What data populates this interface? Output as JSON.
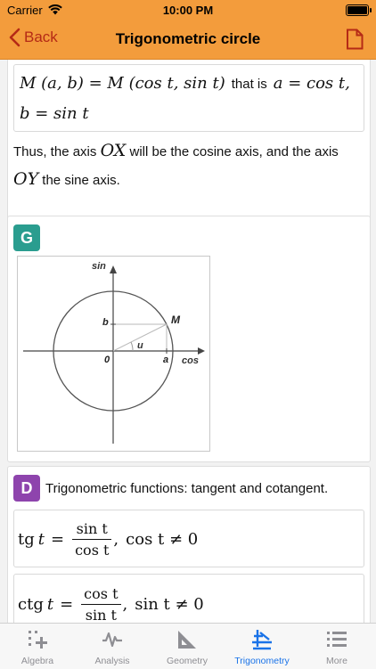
{
  "status_bar": {
    "carrier": "Carrier",
    "time": "10:00 PM"
  },
  "nav": {
    "back_label": "Back",
    "title": "Trigonometric circle"
  },
  "section_top": {
    "formula": {
      "lhs": "M (a, b) = M (cos t, sin t)",
      "connector": "that is",
      "rhs1": "a = cos t,",
      "rhs2": "b = sin t"
    },
    "paragraph": {
      "p1": "Thus, the axis",
      "axis1": "OX",
      "p2": "will be the cosine axis, and the axis",
      "axis2": "OY",
      "p3": "the sine axis."
    }
  },
  "section_g": {
    "badge": "G",
    "badge_color": "#2a9d8f",
    "diagram_labels": {
      "sin": "sin",
      "cos": "cos",
      "M": "M",
      "b": "b",
      "a": "a",
      "u": "u",
      "origin": "0"
    }
  },
  "section_d": {
    "badge": "D",
    "badge_color": "#8e44ad",
    "heading": "Trigonometric functions: tangent and cotangent.",
    "tangent": {
      "name": "tg",
      "var": "t",
      "num": "sin t",
      "den": "cos t",
      "condition": "cos t ≠ 0"
    },
    "cotangent": {
      "name": "ctg",
      "var": "t",
      "num": "cos t",
      "den": "sin t",
      "condition": "sin t ≠ 0"
    }
  },
  "tab_bar": {
    "items": [
      {
        "label": "Algebra",
        "icon": "algebra-icon"
      },
      {
        "label": "Analysis",
        "icon": "analysis-icon"
      },
      {
        "label": "Geometry",
        "icon": "geometry-icon"
      },
      {
        "label": "Trigonometry",
        "icon": "trigonometry-icon"
      },
      {
        "label": "More",
        "icon": "more-icon"
      }
    ],
    "active_index": 3,
    "active_color": "#1a73e8",
    "inactive_color": "#8e8e93"
  },
  "colors": {
    "accent": "#f39c3c",
    "back_text": "#b52a16"
  }
}
